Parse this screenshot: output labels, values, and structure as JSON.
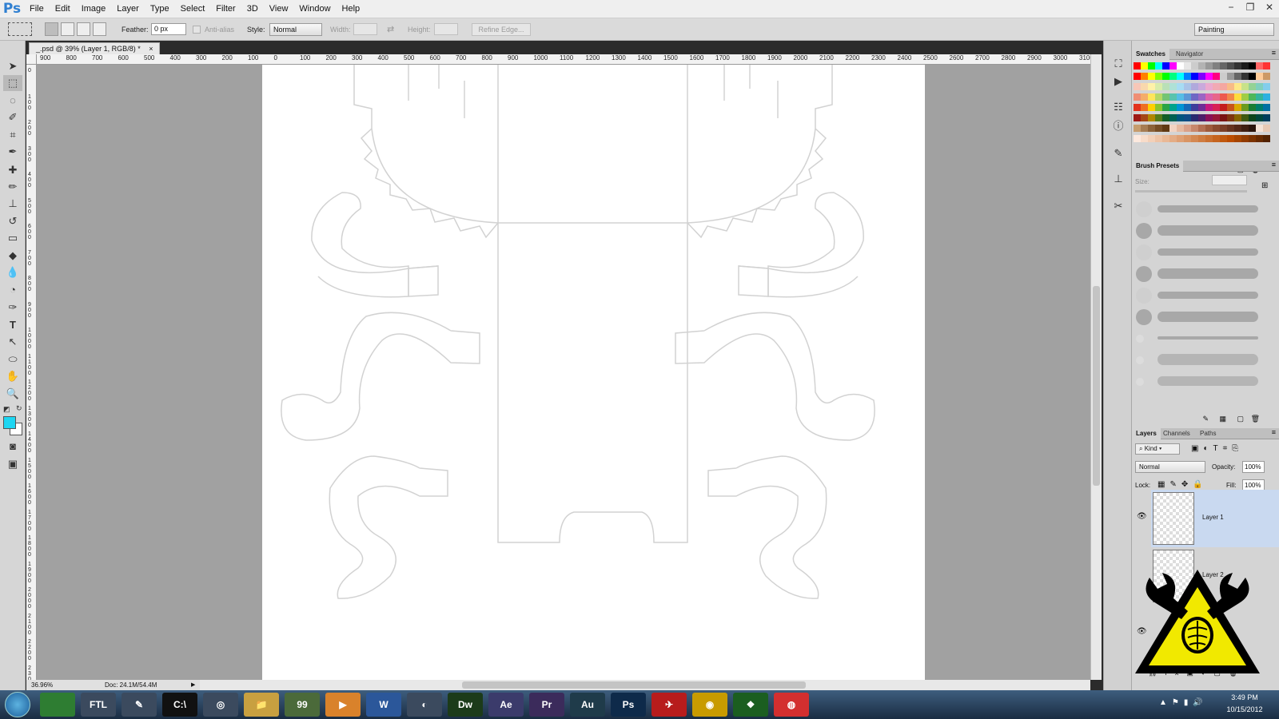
{
  "app": {
    "logo": "Ps"
  },
  "menu": [
    "File",
    "Edit",
    "Image",
    "Layer",
    "Type",
    "Select",
    "Filter",
    "3D",
    "View",
    "Window",
    "Help"
  ],
  "window_controls": {
    "minimize": "−",
    "restore": "❐",
    "close": "✕"
  },
  "options_bar": {
    "feather_label": "Feather:",
    "feather_value": "0 px",
    "anti_alias_label": "Anti-alias",
    "style_label": "Style:",
    "style_value": "Normal",
    "width_label": "Width:",
    "height_label": "Height:",
    "refine_edge": "Refine Edge...",
    "workspace": "Painting"
  },
  "document": {
    "tab_title": "_.psd @ 39% (Layer 1, RGB/8) *",
    "close": "×"
  },
  "status": {
    "zoom": "36.96%",
    "doc_size": "Doc: 24.1M/54.4M"
  },
  "ruler_top": [
    "900",
    "800",
    "700",
    "600",
    "500",
    "400",
    "300",
    "200",
    "100",
    "0",
    "100",
    "200",
    "300",
    "400",
    "500",
    "600",
    "700",
    "800",
    "900",
    "1000",
    "1100",
    "1200",
    "1300",
    "1400",
    "1500",
    "1600",
    "1700",
    "1800",
    "1900",
    "2000",
    "2100",
    "2200",
    "2300",
    "2400",
    "2500",
    "2600",
    "2700",
    "2800",
    "2900",
    "3000",
    "3100"
  ],
  "ruler_left": [
    "0",
    "1 0 0",
    "2 0 0",
    "3 0 0",
    "4 0 0",
    "5 0 0",
    "6 0 0",
    "7 0 0",
    "8 0 0",
    "9 0 0",
    "1 0 0 0",
    "1 1 0 0",
    "1 2 0 0",
    "1 3 0 0",
    "1 4 0 0",
    "1 5 0 0",
    "1 6 0 0",
    "1 7 0 0",
    "1 8 0 0",
    "1 9 0 0",
    "2 0 0 0",
    "2 1 0 0",
    "2 2 0 0",
    "2 3 0 0"
  ],
  "panels": {
    "swatches_tab": "Swatches",
    "navigator_tab": "Navigator",
    "brush_presets_tab": "Brush Presets",
    "size_label": "Size:",
    "layers_tab": "Layers",
    "channels_tab": "Channels",
    "paths_tab": "Paths",
    "kind_filter": "Kind",
    "blend_mode": "Normal",
    "opacity_label": "Opacity:",
    "opacity_value": "100%",
    "lock_label": "Lock:",
    "fill_label": "Fill:",
    "fill_value": "100%",
    "layers": [
      {
        "name": "Layer 1",
        "selected": true
      },
      {
        "name": "Layer 2",
        "selected": false
      }
    ]
  },
  "swatch_colors": {
    "row1": [
      "#ff0000",
      "#ffff00",
      "#00ff00",
      "#00ffff",
      "#0000ff",
      "#ff00ff",
      "#ffffff",
      "#e6e6e6",
      "#cccccc",
      "#b3b3b3",
      "#999999",
      "#808080",
      "#666666",
      "#4d4d4d",
      "#333333",
      "#1a1a1a",
      "#000000",
      "#ff6666",
      "#ff3333"
    ],
    "row2": [
      "#ff0000",
      "#ff8000",
      "#ffff00",
      "#80ff00",
      "#00ff00",
      "#00ff80",
      "#00ffff",
      "#0080ff",
      "#0000ff",
      "#8000ff",
      "#ff00ff",
      "#ff0080",
      "#cccccc",
      "#999999",
      "#666666",
      "#333333",
      "#000000",
      "#ffcc99",
      "#cc9966"
    ],
    "row3": [
      "#f7c7b8",
      "#f9d8ad",
      "#fff1a8",
      "#d9ecaa",
      "#b9e0b7",
      "#afe1d6",
      "#a7dcf3",
      "#a9c3e7",
      "#b0a9dc",
      "#c9a9dc",
      "#eba9cf",
      "#f1a9b4",
      "#f4a7a1",
      "#f8bb86",
      "#fde887",
      "#c8e28a",
      "#94d295",
      "#80cfbe",
      "#82cdec"
    ],
    "row4": [
      "#ef8f75",
      "#f4ad6a",
      "#ffe55a",
      "#b6d865",
      "#74c474",
      "#5ac3ad",
      "#57bde5",
      "#5d98d6",
      "#6f68c4",
      "#9b66c4",
      "#db63ad",
      "#e7658a",
      "#ed5a4f",
      "#f2884a",
      "#fddc3f",
      "#9fcd46",
      "#4db75a",
      "#33b49c",
      "#2db0e0"
    ],
    "row5": [
      "#e3331d",
      "#ee6f22",
      "#ffd000",
      "#8bc42d",
      "#2ba446",
      "#00a38b",
      "#0094d4",
      "#1569b7",
      "#3e3d9b",
      "#6e2d96",
      "#c4197e",
      "#d81f55",
      "#c41d1d",
      "#c9541a",
      "#d9a800",
      "#6c9b1f",
      "#1a7d34",
      "#007c6a",
      "#006fa3"
    ],
    "row6": [
      "#9e1a15",
      "#a44616",
      "#b08600",
      "#557a18",
      "#135f27",
      "#006052",
      "#00557e",
      "#0e4b85",
      "#2a2a70",
      "#4d1e69",
      "#891058",
      "#961638",
      "#7a1313",
      "#7e3510",
      "#856400",
      "#3f5a11",
      "#0d451c",
      "#00463c",
      "#003d5c"
    ],
    "row7": [
      "#c69c6d",
      "#a67c52",
      "#8c6239",
      "#754c24",
      "#603913",
      "#f2d3c2",
      "#e6b9a0",
      "#d9a088",
      "#c7876c",
      "#b36e52",
      "#9e5a3c",
      "#8a4a2f",
      "#7a3e27",
      "#66331f",
      "#532818",
      "#3f1e11",
      "#2b140b",
      "#f5e3d6",
      "#e8c9b4"
    ],
    "row8": [
      "#fde9de",
      "#f8dcc9",
      "#f3d0b8",
      "#eec4a7",
      "#e9b896",
      "#e4ac85",
      "#dfa074",
      "#d99463",
      "#d48852",
      "#cf7c41",
      "#ca7030",
      "#c5641f",
      "#c0580e",
      "#bb4c00",
      "#a64400",
      "#913b00",
      "#7c3300",
      "#672a00",
      "#522200"
    ]
  },
  "taskbar_apps": [
    {
      "label": "",
      "color": "#2e7d32"
    },
    {
      "label": "FTL",
      "color": "#3b4a5e"
    },
    {
      "label": "✎",
      "color": "#3b4a5e"
    },
    {
      "label": "C:\\",
      "color": "#111111"
    },
    {
      "label": "◎",
      "color": "#3b4a5e"
    },
    {
      "label": "📁",
      "color": "#c8a040"
    },
    {
      "label": "99",
      "color": "#4b6a3a"
    },
    {
      "label": "▶",
      "color": "#d9822b"
    },
    {
      "label": "W",
      "color": "#2b579a"
    },
    {
      "label": "◐",
      "color": "#3b4a5e"
    },
    {
      "label": "Dw",
      "color": "#1c3b1a"
    },
    {
      "label": "Ae",
      "color": "#3b3b6b"
    },
    {
      "label": "Pr",
      "color": "#3b2b5b"
    },
    {
      "label": "Au",
      "color": "#1f3b4a"
    },
    {
      "label": "Ps",
      "color": "#0e2a4a"
    },
    {
      "label": "✈",
      "color": "#b71c1c"
    },
    {
      "label": "◉",
      "color": "#c89b00"
    },
    {
      "label": "❖",
      "color": "#1b5e20"
    },
    {
      "label": "◍",
      "color": "#d32f2f"
    }
  ],
  "clock": {
    "time": "3:49 PM",
    "date": "10/15/2012"
  }
}
